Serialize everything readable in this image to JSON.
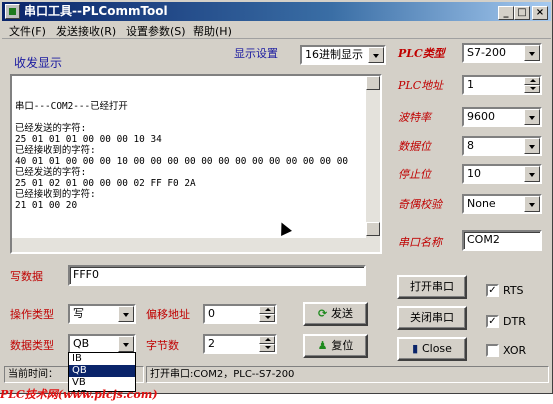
{
  "window": {
    "title": "串口工具--PLCommTool"
  },
  "menu": [
    "文件(F)",
    "发送接收(R)",
    "设置参数(S)",
    "帮助(H)"
  ],
  "receive": {
    "group_label": "收发显示",
    "display_setting_label": "显示设置",
    "display_mode": "16进制显示",
    "log": "串口---COM2---已经打开\n\n已经发送的字符:\n25 01 01 01 00 00 00 10 34\n已经接收到的字符:\n40 01 01 00 00 00 10 00 00 00 00 00 00 00 00 00 00 00 00 00\n已经发送的字符:\n25 01 02 01 00 00 00 02 FF F0 2A\n已经接收到的字符:\n21 01 00 20"
  },
  "write": {
    "label": "写数据",
    "value": "FFF0"
  },
  "operation": {
    "op_type_label": "操作类型",
    "op_type": "写",
    "data_type_label": "数据类型",
    "data_type": "QB",
    "offset_label": "偏移地址",
    "offset": "0",
    "bytes_label": "字节数",
    "bytes": "2",
    "send_label": "发送",
    "reset_label": "复位"
  },
  "dropdown_options": [
    "IB",
    "QB",
    "VB",
    "MB"
  ],
  "settings": {
    "plc_type_label": "PLC类型",
    "plc_type": "S7-200",
    "plc_addr_label": "PLC地址",
    "plc_addr": "1",
    "baud_label": "波特率",
    "baud": "9600",
    "databits_label": "数据位",
    "databits": "8",
    "stopbits_label": "停止位",
    "stopbits": "10",
    "parity_label": "奇偶校验",
    "parity": "None",
    "port_label": "串口名称",
    "port": "COM2"
  },
  "buttons": {
    "open": "打开串口",
    "close": "关闭串口",
    "exit": "Close"
  },
  "checks": {
    "rts": "RTS",
    "dtr": "DTR",
    "xor": "XOR",
    "rts_checked": true,
    "dtr_checked": true,
    "xor_checked": false
  },
  "status": {
    "time_label": "当前时间：",
    "message": "打开串口:COM2，PLC--S7-200"
  },
  "watermark": "PLC技术网(www.plcjs.com)",
  "colors": {
    "title_start": "#0a246a",
    "label_red": "#c00000",
    "label_blue": "#1a1aa0"
  }
}
